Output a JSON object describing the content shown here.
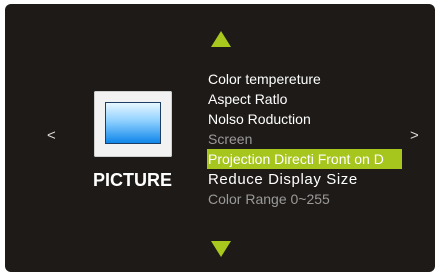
{
  "colors": {
    "panel_bg": "#1e1a17",
    "accent": "#a6c51d",
    "text": "#ffffff",
    "disabled_text": "#9a9a9a"
  },
  "nav": {
    "up_icon": "triangle-up",
    "down_icon": "triangle-down",
    "left_glyph": "<",
    "right_glyph": ">"
  },
  "category": {
    "icon": "picture-icon",
    "label": "PICTURE"
  },
  "menu": {
    "items": [
      {
        "label": "Color tempereture",
        "state": "active"
      },
      {
        "label": "Aspect Ratlo",
        "state": "active"
      },
      {
        "label": "Nolso Roduction",
        "state": "active"
      },
      {
        "label": "Screen",
        "state": "disabled"
      },
      {
        "label": "Projection Directi  Front on D",
        "state": "selected"
      },
      {
        "label": "Reduce  Display Size",
        "state": "active"
      },
      {
        "label": "Color Range 0~255",
        "state": "disabled"
      }
    ]
  }
}
